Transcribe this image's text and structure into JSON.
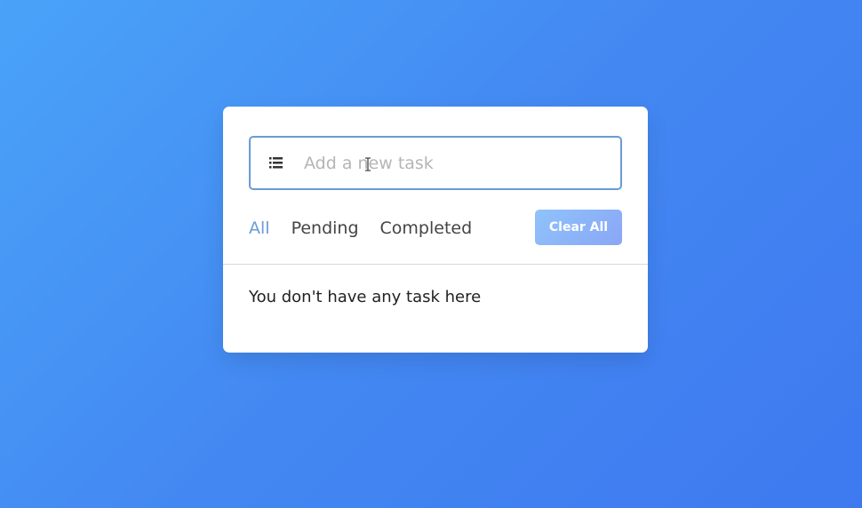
{
  "task_input": {
    "placeholder": "Add a new task",
    "value": ""
  },
  "filters": [
    {
      "label": "All",
      "active": true
    },
    {
      "label": "Pending",
      "active": false
    },
    {
      "label": "Completed",
      "active": false
    }
  ],
  "clear_button": {
    "label": "Clear All"
  },
  "task_list": {
    "empty_message": "You don't have any task here"
  },
  "icons": {
    "input_icon": "list-icon"
  },
  "colors": {
    "background_gradient_start": "#4aa3f8",
    "background_gradient_end": "#3e79f0",
    "accent": "#6a9bd6",
    "button_gradient_start": "#8fc3fb",
    "button_gradient_end": "#8aa6f6"
  }
}
